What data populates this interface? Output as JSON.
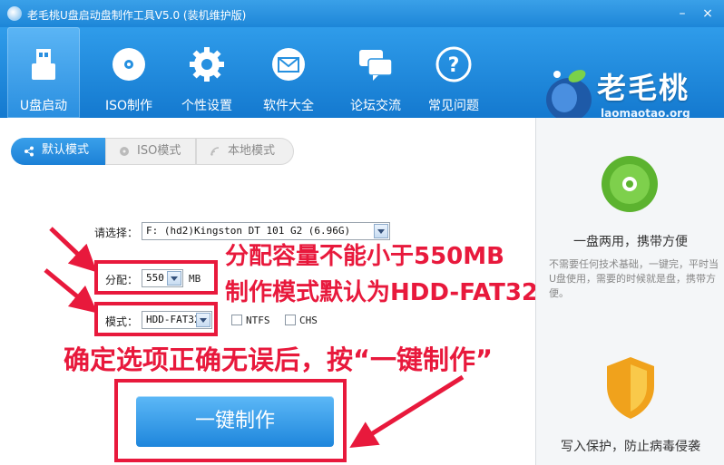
{
  "window": {
    "title": "老毛桃U盘启动盘制作工具V5.0 (装机维护版)",
    "minimize": "–",
    "close": "×"
  },
  "nav": {
    "items": [
      {
        "label": "U盘启动",
        "icon": "usb-drive-icon"
      },
      {
        "label": "ISO制作",
        "icon": "disc-icon"
      },
      {
        "label": "个性设置",
        "icon": "gear-icon"
      },
      {
        "label": "软件大全",
        "icon": "mail-icon"
      },
      {
        "label": "论坛交流",
        "icon": "chat-bubble-icon"
      },
      {
        "label": "常见问题",
        "icon": "question-icon"
      }
    ],
    "active_index": 0
  },
  "brand": {
    "name": "老毛桃",
    "url": "laomaotao.org"
  },
  "mode_tabs": [
    {
      "label": "默认模式",
      "active": true
    },
    {
      "label": "ISO模式",
      "active": false
    },
    {
      "label": "本地模式",
      "active": false
    }
  ],
  "form": {
    "device_label": "请选择：",
    "device_value": "F: (hd2)Kingston DT 101 G2 (6.96G)",
    "alloc_label": "分配：",
    "alloc_value": "550",
    "alloc_unit": "MB",
    "mode_label": "模式：",
    "mode_value": "HDD-FAT32",
    "ntfs_label": "NTFS",
    "chs_label": "CHS"
  },
  "annotations": {
    "line1": "分配容量不能小于550MB",
    "line2": "制作模式默认为HDD-FAT32",
    "line3": "确定选项正确无误后，按“一键制作”"
  },
  "make_button": "一键制作",
  "sidebar": {
    "feature1_title": "一盘两用，携带方便",
    "feature1_desc": "不需要任何技术基础，一键完，平时当U盘使用，需要的时候就是盘，携带方便。",
    "feature2_title": "写入保护，防止病毒侵袭"
  },
  "colors": {
    "accent_blue": "#1d86d8",
    "annotation_red": "#e8193c"
  }
}
